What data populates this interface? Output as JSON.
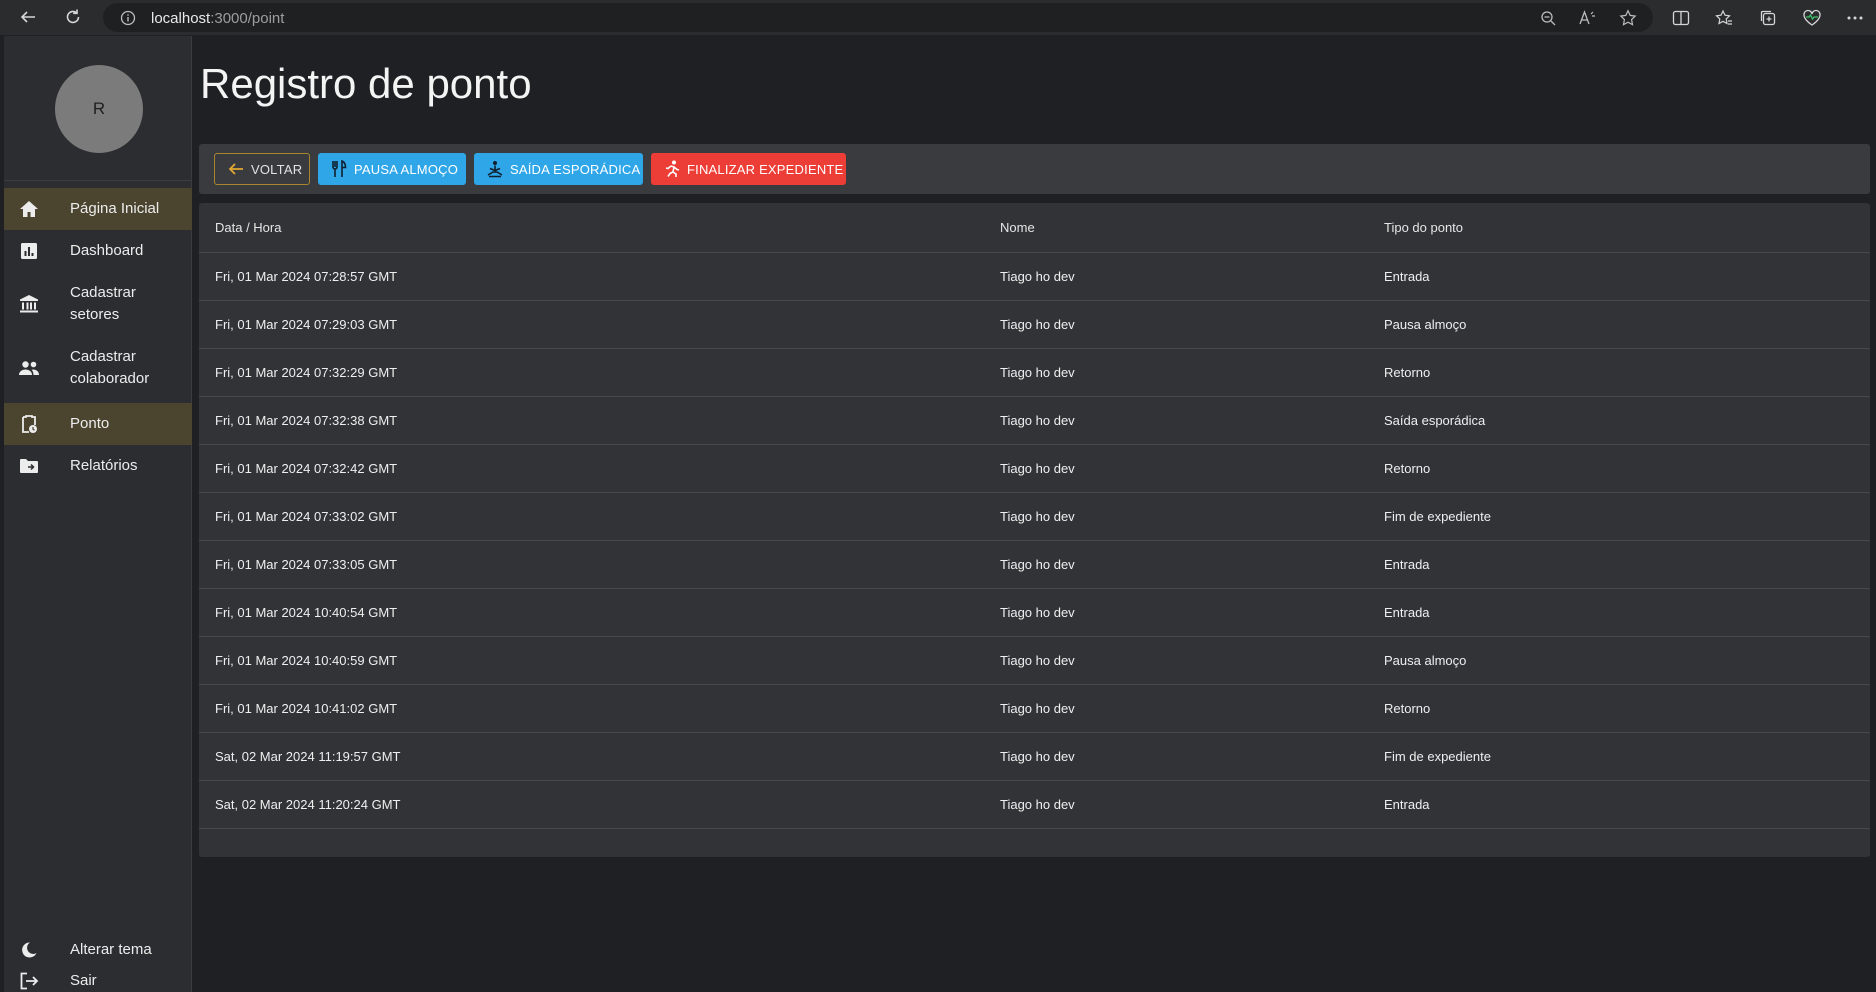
{
  "browser": {
    "url_host": "localhost",
    "url_path": ":3000/point"
  },
  "sidebar": {
    "avatar_initial": "R",
    "items": [
      {
        "label": "Página Inicial",
        "icon": "home-icon"
      },
      {
        "label": "Dashboard",
        "icon": "chart-icon"
      },
      {
        "label": "Cadastrar setores",
        "icon": "bank-icon"
      },
      {
        "label": "Cadastrar colaborador",
        "icon": "people-icon"
      },
      {
        "label": "Ponto",
        "icon": "clipboard-clock-icon"
      },
      {
        "label": "Relatórios",
        "icon": "folder-icon"
      }
    ],
    "footer": [
      {
        "label": "Alterar tema",
        "icon": "moon-icon"
      },
      {
        "label": "Sair",
        "icon": "logout-icon"
      }
    ]
  },
  "main": {
    "title": "Registro de ponto",
    "buttons": {
      "back": "VOLTAR",
      "lunch": "PAUSA ALMOÇO",
      "sporadic": "SAÍDA ESPORÁDICA",
      "finish": "FINALIZAR EXPEDIENTE"
    },
    "table": {
      "headers": [
        "Data / Hora",
        "Nome",
        "Tipo do ponto"
      ],
      "rows": [
        [
          "Fri, 01 Mar 2024 07:28:57 GMT",
          "Tiago ho dev",
          "Entrada"
        ],
        [
          "Fri, 01 Mar 2024 07:29:03 GMT",
          "Tiago ho dev",
          "Pausa almoço"
        ],
        [
          "Fri, 01 Mar 2024 07:32:29 GMT",
          "Tiago ho dev",
          "Retorno"
        ],
        [
          "Fri, 01 Mar 2024 07:32:38 GMT",
          "Tiago ho dev",
          "Saída esporádica"
        ],
        [
          "Fri, 01 Mar 2024 07:32:42 GMT",
          "Tiago ho dev",
          "Retorno"
        ],
        [
          "Fri, 01 Mar 2024 07:33:02 GMT",
          "Tiago ho dev",
          "Fim de expediente"
        ],
        [
          "Fri, 01 Mar 2024 07:33:05 GMT",
          "Tiago ho dev",
          "Entrada"
        ],
        [
          "Fri, 01 Mar 2024 10:40:54 GMT",
          "Tiago ho dev",
          "Entrada"
        ],
        [
          "Fri, 01 Mar 2024 10:40:59 GMT",
          "Tiago ho dev",
          "Pausa almoço"
        ],
        [
          "Fri, 01 Mar 2024 10:41:02 GMT",
          "Tiago ho dev",
          "Retorno"
        ],
        [
          "Sat, 02 Mar 2024 11:19:57 GMT",
          "Tiago ho dev",
          "Fim de expediente"
        ],
        [
          "Sat, 02 Mar 2024 11:20:24 GMT",
          "Tiago ho dev",
          "Entrada"
        ]
      ]
    }
  },
  "colors": {
    "accent_gold": "#a9852f",
    "active_item_bg": "#4b4530",
    "info_blue": "#2fa6e8",
    "danger_red": "#ec3d36"
  }
}
